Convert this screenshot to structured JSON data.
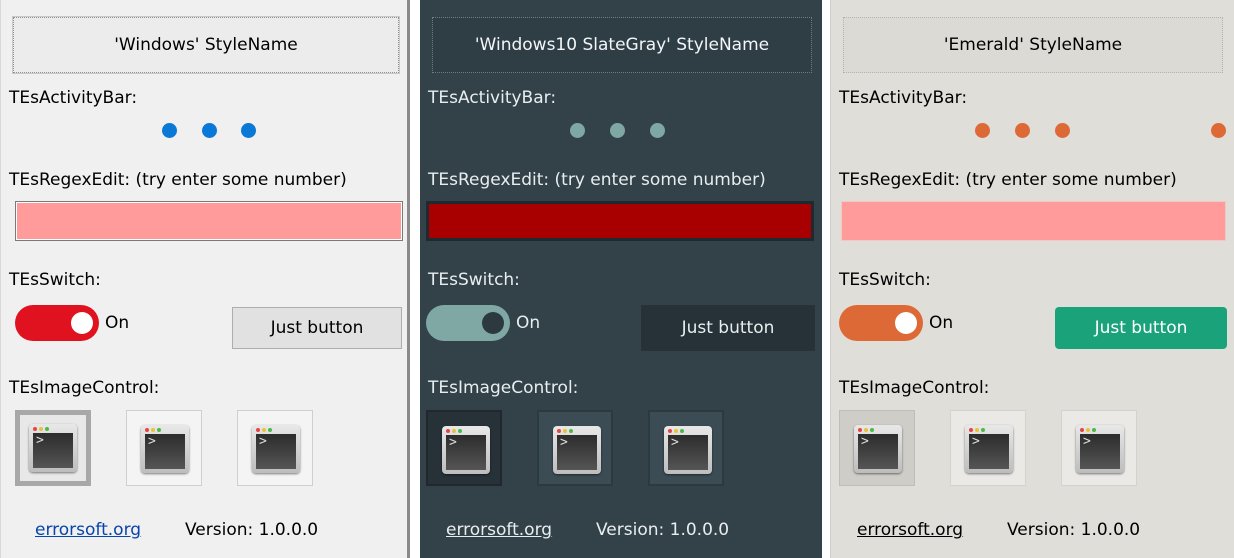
{
  "panels": [
    {
      "title": "'Windows' StyleName",
      "activity_label": "TEsActivityBar:",
      "regex_label": "TEsRegexEdit: (try enter some number)",
      "switch_label": "TEsSwitch:",
      "switch_state": "On",
      "button_label": "Just button",
      "image_label": "TEsImageControl:",
      "link": "errorsoft.org",
      "version": "Version: 1.0.0.0"
    },
    {
      "title": "'Windows10 SlateGray' StyleName",
      "activity_label": "TEsActivityBar:",
      "regex_label": "TEsRegexEdit: (try enter some number)",
      "switch_label": "TEsSwitch:",
      "switch_state": "On",
      "button_label": "Just button",
      "image_label": "TEsImageControl:",
      "link": "errorsoft.org",
      "version": "Version: 1.0.0.0"
    },
    {
      "title": "'Emerald' StyleName",
      "activity_label": "TEsActivityBar:",
      "regex_label": "TEsRegexEdit: (try enter some number)",
      "switch_label": "TEsSwitch:",
      "switch_state": "On",
      "button_label": "Just button",
      "image_label": "TEsImageControl:",
      "link": "errorsoft.org",
      "version": "Version: 1.0.0.0"
    }
  ],
  "colors": {
    "windows_accent": "#0a78d7",
    "windows_switch": "#e0121f",
    "windows_edit": "#ff9b9b",
    "slate_bg": "#334149",
    "slate_accent": "#7fa8a4",
    "slate_edit": "#a80000",
    "emerald_bg": "#e0ded9",
    "emerald_accent": "#dd6a36",
    "emerald_button": "#1aa37a",
    "emerald_edit": "#ff9b9b"
  },
  "icons": {
    "image_control": "terminal-window-icon"
  }
}
